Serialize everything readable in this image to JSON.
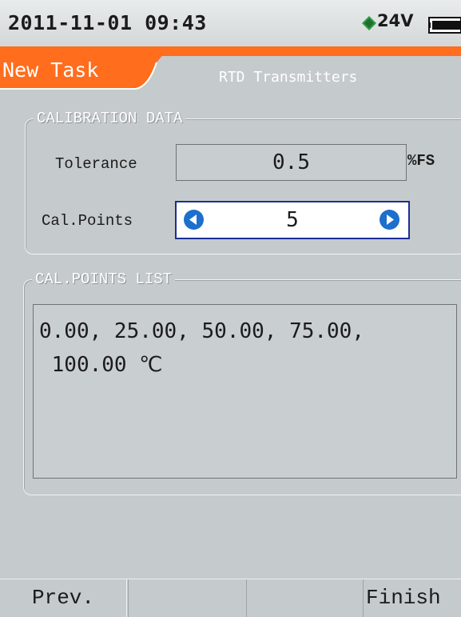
{
  "status_bar": {
    "datetime": "2011-11-01 09:43",
    "voltage": "24V",
    "icons": [
      "power-diamond-icon",
      "battery-icon"
    ]
  },
  "header": {
    "active_tab": "New Task",
    "screen_title": "RTD Transmitters",
    "accent_color": "#ff6d1d"
  },
  "calibration_data": {
    "legend": "CALIBRATION DATA",
    "tolerance_label": "Tolerance",
    "tolerance_value": "0.5",
    "tolerance_unit": "%FS",
    "cal_points_label": "Cal.Points",
    "cal_points_value": "5",
    "stepper_icons": [
      "decrease-arrow-icon",
      "increase-arrow-icon"
    ],
    "stepper_color": "#1c6fcd"
  },
  "cal_points_list": {
    "legend": "CAL.POINTS LIST",
    "text": "0.00, 25.00, 50.00, 75.00,\n 100.00 ℃"
  },
  "softkeys": [
    "Prev.",
    "",
    "",
    "Finish"
  ]
}
